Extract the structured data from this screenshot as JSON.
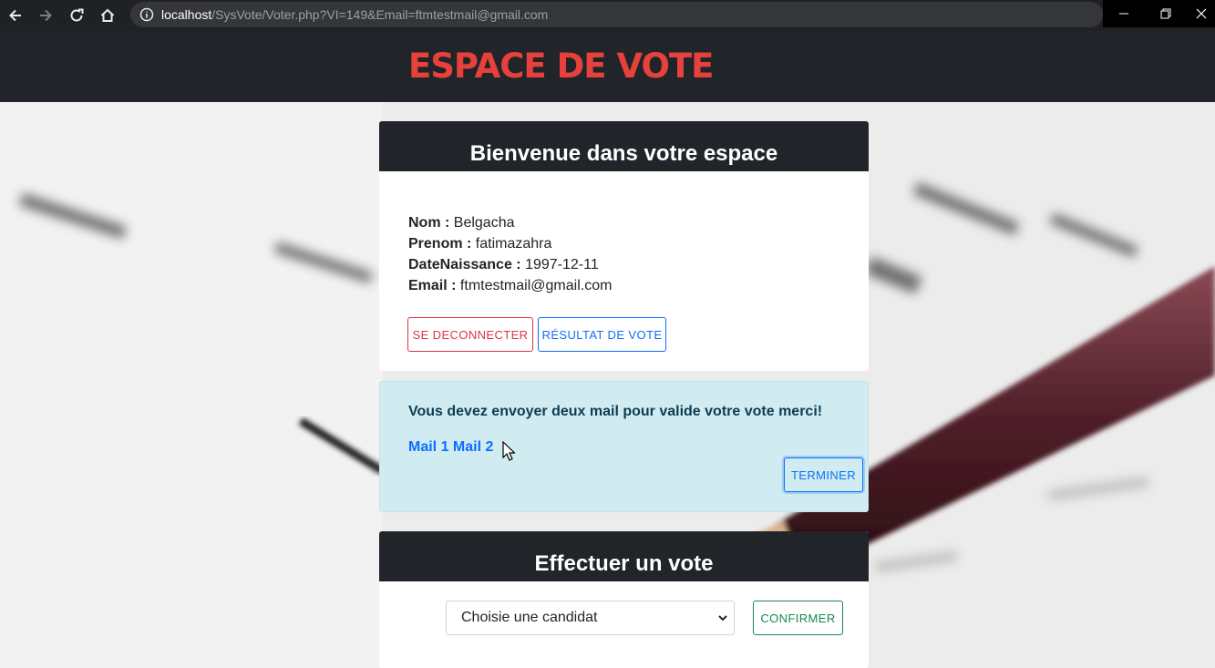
{
  "browser": {
    "url_host": "localhost",
    "url_path": "/SysVote/Voter.php?VI=149&Email=ftmtestmail@gmail.com"
  },
  "site": {
    "title": "ESPACE DE VOTE"
  },
  "welcome_card": {
    "title": "Bienvenue dans votre espace",
    "fields": [
      {
        "label": "Nom :",
        "value": "Belgacha"
      },
      {
        "label": "Prenom :",
        "value": "fatimazahra"
      },
      {
        "label": "DateNaissance :",
        "value": "1997-12-11"
      },
      {
        "label": "Email :",
        "value": "ftmtestmail@gmail.com"
      }
    ],
    "logout_label": "SE DECONNECTER",
    "results_label": "RÉSULTAT DE VOTE"
  },
  "alert": {
    "message": "Vous devez envoyer deux mail pour valide votre vote merci!",
    "link1": "Mail 1",
    "link2": "Mail 2",
    "finish_label": "TERMINER"
  },
  "vote_card": {
    "title": "Effectuer un vote",
    "select_placeholder": "Choisie une candidat",
    "confirm_label": "CONFIRMER"
  }
}
